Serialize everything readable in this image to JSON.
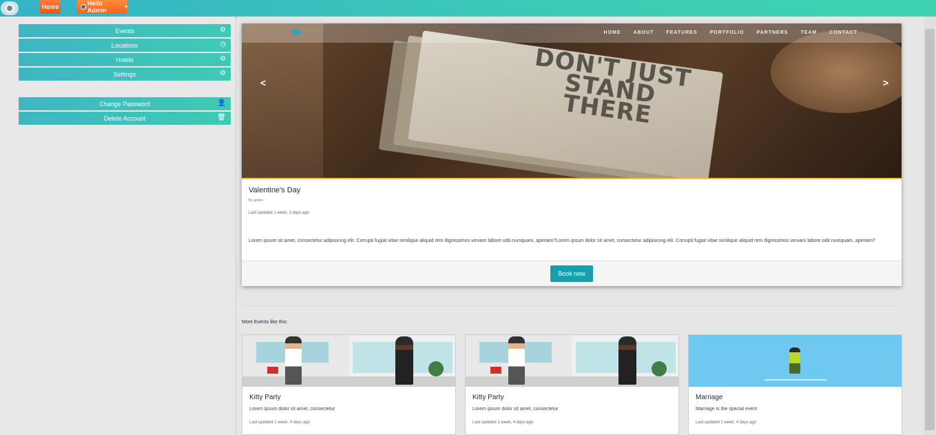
{
  "topbar": {
    "home_label": "Home",
    "admin_label": "Hello Admin"
  },
  "sidebar": {
    "items": [
      {
        "label": "Events",
        "icon": "gears-icon"
      },
      {
        "label": "Locations",
        "icon": "clock-icon"
      },
      {
        "label": "Hotels",
        "icon": "gears-icon"
      },
      {
        "label": "Settings",
        "icon": "gears-icon"
      }
    ],
    "account": [
      {
        "label": "Change Password",
        "icon": "user-minus-icon"
      },
      {
        "label": "Delete Account",
        "icon": "trash-icon"
      }
    ]
  },
  "featured": {
    "hero": {
      "nav_links": [
        "HOME",
        "ABOUT",
        "FEATURES",
        "PORTFOLIO",
        "PARTNERS",
        "TEAM",
        "CONTACT"
      ],
      "poster_text": "DON'T JUST STAND THERE"
    },
    "title": "Valentine's Day",
    "by": "By admin",
    "updated": "Last updated 1 week, 3 days ago",
    "description": "Lorem ipsum sit amet, consectetur adipisicing elit. Corrupti fugiat vitae similique aliquid rem dignissimos veniam labore odit numquam, aperiam?Lorem ipsum dolor sit amet, consectetur adipisicing elit. Corrupti fugiat vitae similique aliquid rem dignissimos veniam labore odit numquam, aperiam?",
    "book_label": "Book now"
  },
  "more": {
    "label": "More Events like this:",
    "events": [
      {
        "title": "Kitty Party",
        "desc": "Lorem ipsum dolor sit amet, consectetur",
        "updated": "Last updated 1 week, 4 days ago"
      },
      {
        "title": "Kitty Party",
        "desc": "Lorem ipsum dolor sit amet, consectetur",
        "updated": "Last updated 1 week, 4 days ago"
      },
      {
        "title": "Marriage",
        "desc": "Marriage is the special event",
        "updated": "Last updated 1 week, 4 days ago"
      }
    ]
  }
}
